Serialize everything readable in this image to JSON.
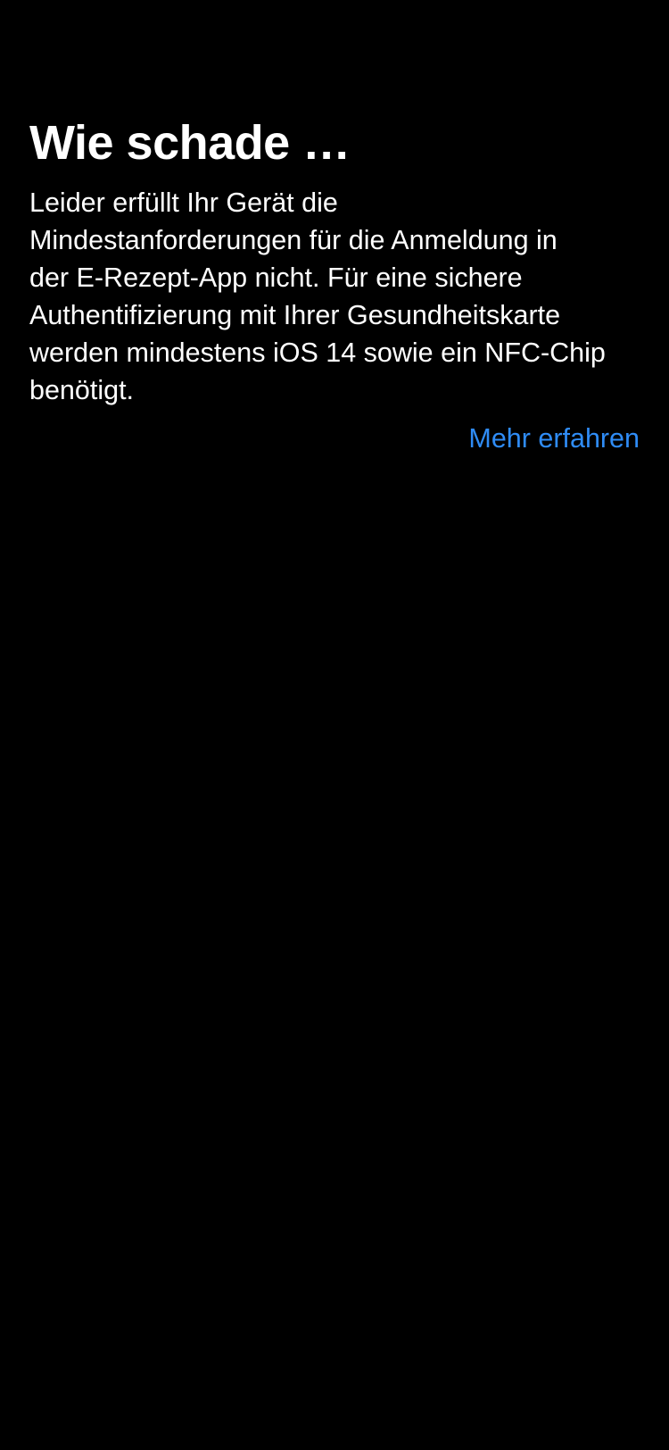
{
  "screen": {
    "title": "Wie schade …",
    "message": "Leider erfüllt Ihr Gerät die\nMindestanforderungen für die Anmeldung in\nder E-Rezept-App nicht. Für eine sichere\nAuthentifizierung mit Ihrer Gesundheitskarte\nwerden mindestens iOS 14 sowie ein NFC-Chip\nbenötigt.",
    "learn_more_label": "Mehr erfahren"
  },
  "colors": {
    "background": "#000000",
    "text": "#ffffff",
    "link": "#2f8cf6"
  }
}
